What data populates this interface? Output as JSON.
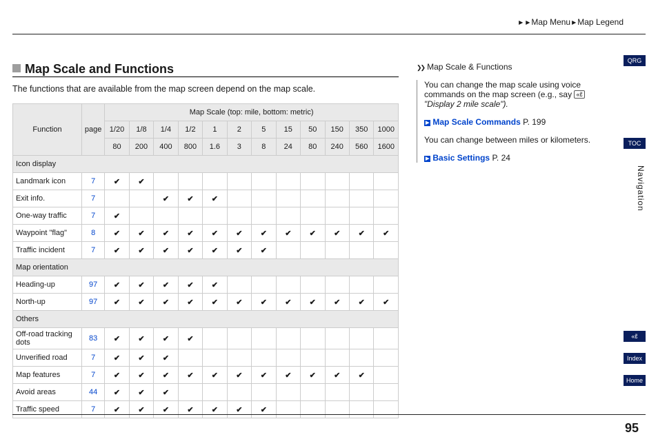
{
  "breadcrumb": {
    "a": "Map Menu",
    "b": "Map Legend"
  },
  "title": "Map Scale and Functions",
  "intro": "The functions that are available from the map screen depend on the map scale.",
  "th": {
    "function": "Function",
    "page": "page",
    "scaleheader": "Map Scale (top: mile, bottom: metric)"
  },
  "scales_top": [
    "1/20",
    "1/8",
    "1/4",
    "1/2",
    "1",
    "2",
    "5",
    "15",
    "50",
    "150",
    "350",
    "1000"
  ],
  "scales_bot": [
    "80",
    "200",
    "400",
    "800",
    "1.6",
    "3",
    "8",
    "24",
    "80",
    "240",
    "560",
    "1600"
  ],
  "sections": [
    {
      "name": "Icon display",
      "rows": [
        {
          "name": "Landmark icon",
          "page": "7",
          "c": [
            1,
            2
          ]
        },
        {
          "name": "Exit info.",
          "page": "7",
          "c": [
            3,
            4,
            5
          ]
        },
        {
          "name": "One-way traffic",
          "page": "7",
          "c": [
            1
          ]
        },
        {
          "name": "Waypoint \"flag\"",
          "page": "8",
          "c": [
            1,
            2,
            3,
            4,
            5,
            6,
            7,
            8,
            9,
            10,
            11,
            12
          ]
        },
        {
          "name": "Traffic incident",
          "page": "7",
          "c": [
            1,
            2,
            3,
            4,
            5,
            6,
            7
          ]
        }
      ]
    },
    {
      "name": "Map orientation",
      "rows": [
        {
          "name": "Heading-up",
          "page": "97",
          "c": [
            1,
            2,
            3,
            4,
            5
          ]
        },
        {
          "name": "North-up",
          "page": "97",
          "c": [
            1,
            2,
            3,
            4,
            5,
            6,
            7,
            8,
            9,
            10,
            11,
            12
          ]
        }
      ]
    },
    {
      "name": "Others",
      "rows": [
        {
          "name": "Off-road tracking dots",
          "page": "83",
          "c": [
            1,
            2,
            3,
            4
          ]
        },
        {
          "name": "Unverified road",
          "page": "7",
          "c": [
            1,
            2,
            3
          ]
        },
        {
          "name": "Map features",
          "page": "7",
          "c": [
            1,
            2,
            3,
            4,
            5,
            6,
            7,
            8,
            9,
            10,
            11
          ]
        },
        {
          "name": "Avoid areas",
          "page": "44",
          "c": [
            1,
            2,
            3
          ]
        },
        {
          "name": "Traffic speed",
          "page": "7",
          "c": [
            1,
            2,
            3,
            4,
            5,
            6,
            7
          ]
        }
      ]
    }
  ],
  "side": {
    "heading": "Map Scale & Functions",
    "p1a": "You can change the map scale using voice commands on the map screen (e.g., say ",
    "p1b": "\"Display 2 mile scale\").",
    "link1": "Map Scale Commands",
    "link1p": "P. 199",
    "p2": "You can change between miles or kilometers.",
    "link2": "Basic Settings",
    "link2p": "P. 24"
  },
  "nav": {
    "qrg": "QRG",
    "toc": "TOC",
    "section": "Navigation",
    "index": "Index",
    "home": "Home"
  },
  "pageno": "95"
}
